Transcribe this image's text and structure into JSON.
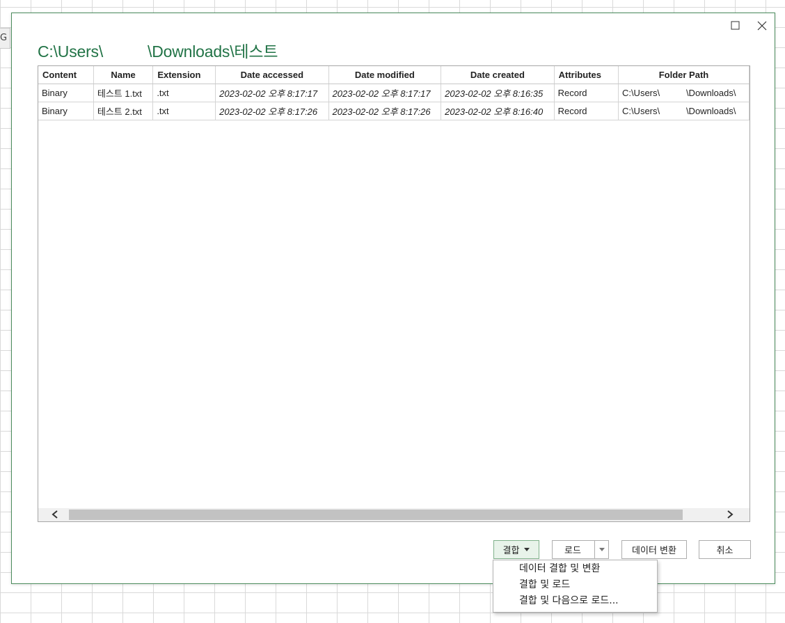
{
  "background": {
    "column_header_fragment": "G"
  },
  "dialog": {
    "title_path_prefix": "C:\\Users\\",
    "title_path_suffix": "\\Downloads\\테스트",
    "table": {
      "columns": [
        "Content",
        "Name",
        "Extension",
        "Date accessed",
        "Date modified",
        "Date created",
        "Attributes",
        "Folder Path"
      ],
      "rows": [
        {
          "content": "Binary",
          "name": "테스트 1.txt",
          "extension": ".txt",
          "date_accessed": "2023-02-02 오후 8:17:17",
          "date_modified": "2023-02-02 오후 8:17:17",
          "date_created": "2023-02-02 오후 8:16:35",
          "attributes": "Record",
          "folder_path_prefix": "C:\\Users\\",
          "folder_path_suffix": "\\Downloads\\"
        },
        {
          "content": "Binary",
          "name": "테스트 2.txt",
          "extension": ".txt",
          "date_accessed": "2023-02-02 오후 8:17:26",
          "date_modified": "2023-02-02 오후 8:17:26",
          "date_created": "2023-02-02 오후 8:16:40",
          "attributes": "Record",
          "folder_path_prefix": "C:\\Users\\",
          "folder_path_suffix": "\\Downloads\\"
        }
      ]
    },
    "buttons": {
      "combine": "결합",
      "load": "로드",
      "transform": "데이터 변환",
      "cancel": "취소"
    },
    "combine_menu": {
      "items": [
        "데이터 결합 및 변환",
        "결합 및 로드",
        "결합 및 다음으로 로드..."
      ]
    }
  },
  "icons": {
    "maximize": "maximize-icon",
    "close": "close-icon",
    "scroll_left": "chevron-left-icon",
    "scroll_right": "chevron-right-icon",
    "dropdown": "caret-down-icon"
  },
  "colors": {
    "accent": "#217346",
    "dialog_border": "#4a8b5c",
    "selected_button": "#e8f3ea"
  }
}
